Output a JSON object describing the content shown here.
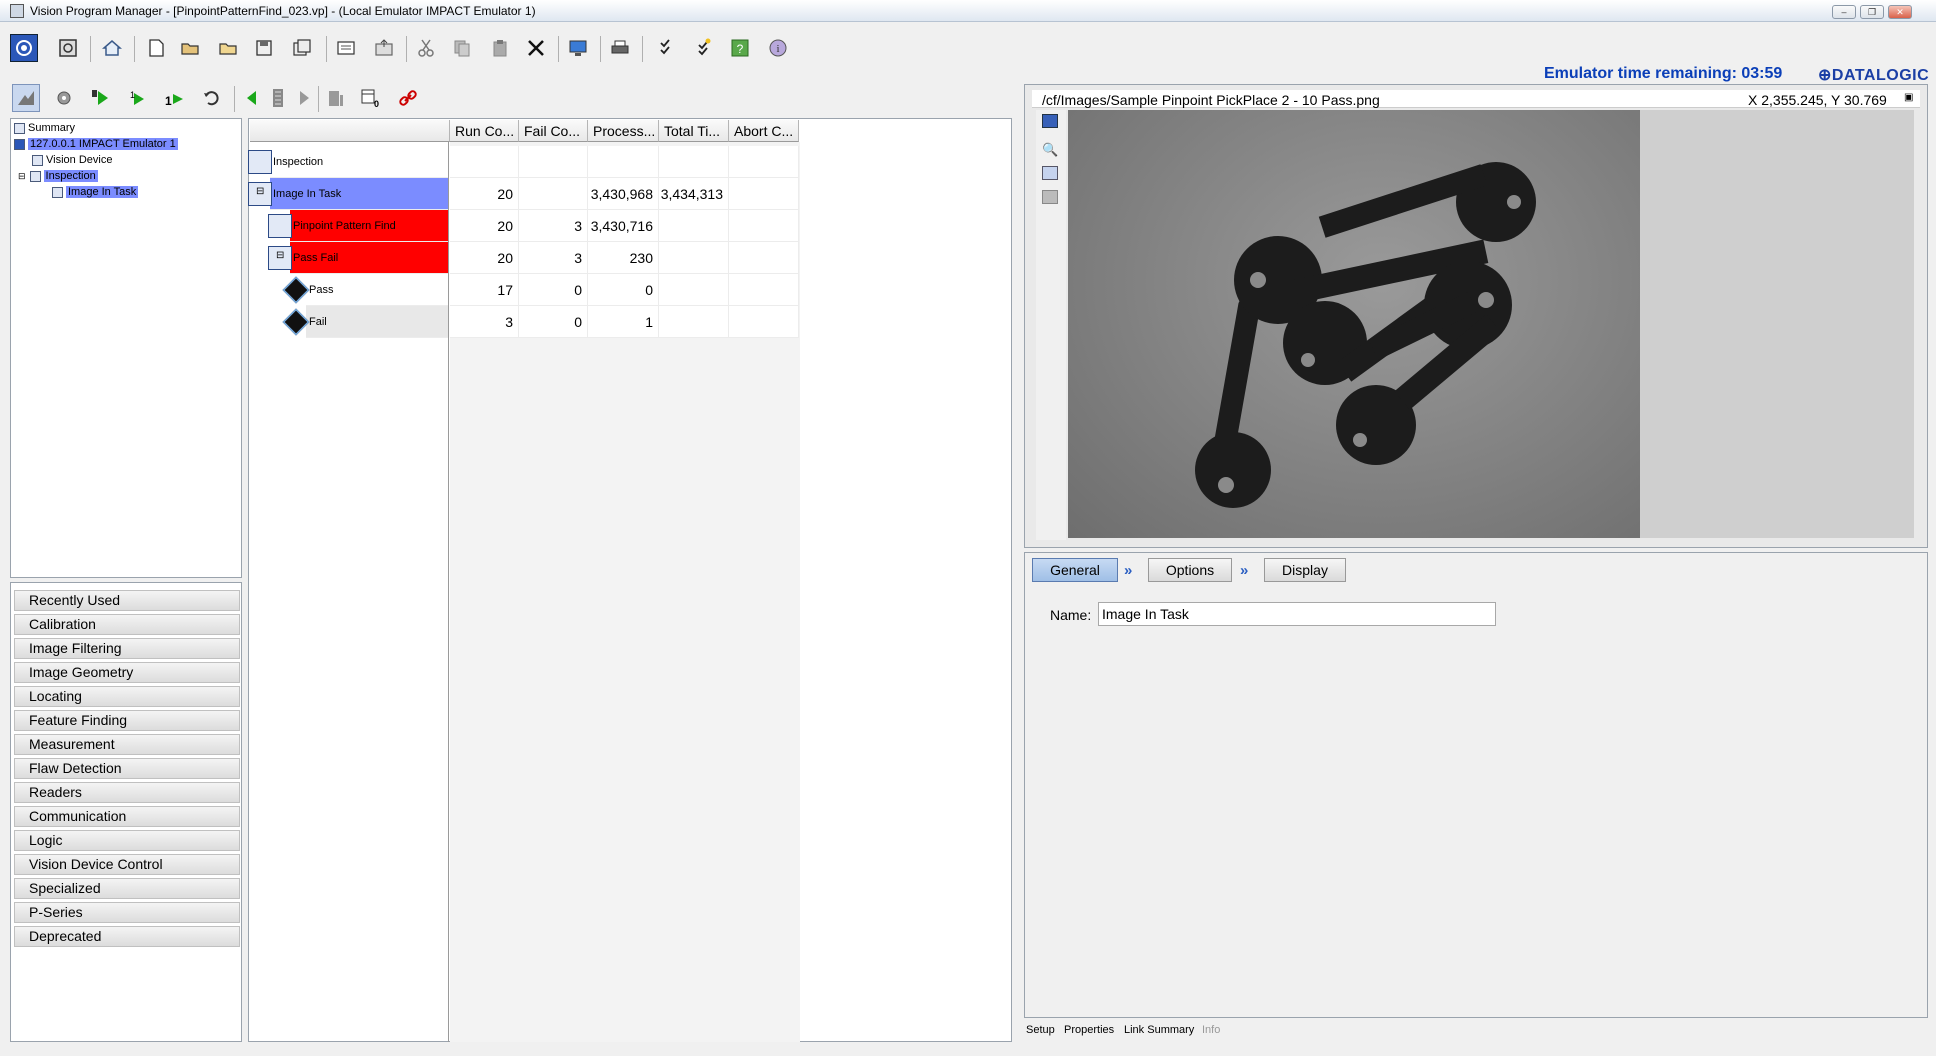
{
  "window": {
    "title": "Vision Program Manager - [PinpointPatternFind_023.vp] - (Local Emulator IMPACT Emulator 1)",
    "controls": [
      "minimize",
      "restore",
      "close"
    ]
  },
  "header": {
    "emulator_time": "Emulator time remaining: 03:59",
    "brand": "⊕DATALOGIC"
  },
  "toolbar_main": {
    "icons": [
      "camera-icon",
      "stop-icon",
      "home-icon",
      "new-file-icon",
      "open-folder-icon",
      "folder-icon",
      "save-icon",
      "save-all-icon",
      "import-icon",
      "export-icon",
      "cut-icon",
      "copy-icon",
      "paste-icon",
      "delete-icon",
      "monitor-icon",
      "print-icon",
      "checklist-icon",
      "checklist-star-icon",
      "help-icon",
      "info-icon"
    ]
  },
  "toolbar_run": {
    "icons": [
      "edit-mode-icon",
      "gear-run-icon",
      "run-icon",
      "run-once-icon",
      "run-step-icon",
      "loop-icon",
      "prev-image-icon",
      "filmstrip-icon",
      "next-image-icon",
      "record-icon",
      "calendar-counter-icon",
      "link-icon"
    ]
  },
  "tree": {
    "items": [
      {
        "label": "Summary"
      },
      {
        "label": "127.0.0.1 IMPACT Emulator 1"
      },
      {
        "label": "Vision Device"
      },
      {
        "label": "Inspection"
      },
      {
        "label": "Image In Task"
      }
    ]
  },
  "categories": [
    "Recently Used",
    "Calibration",
    "Image Filtering",
    "Image Geometry",
    "Locating",
    "Feature Finding",
    "Measurement",
    "Flaw Detection",
    "Readers",
    "Communication",
    "Logic",
    "Vision Device Control",
    "Specialized",
    "P-Series",
    "Deprecated"
  ],
  "grid": {
    "columns": [
      "Run Co...",
      "Fail Co...",
      "Process...",
      "Total Ti...",
      "Abort C..."
    ],
    "rows": [
      {
        "name": "Inspection",
        "run": "",
        "fail": "",
        "process": "",
        "total": "",
        "abort": ""
      },
      {
        "name": "Image In Task",
        "run": "20",
        "fail": "",
        "process": "3,430,968",
        "total": "3,434,313",
        "abort": ""
      },
      {
        "name": "Pinpoint Pattern Find",
        "run": "20",
        "fail": "3",
        "process": "3,430,716",
        "total": "",
        "abort": ""
      },
      {
        "name": "Pass Fail",
        "run": "20",
        "fail": "3",
        "process": "230",
        "total": "",
        "abort": ""
      },
      {
        "name": "Pass",
        "run": "17",
        "fail": "0",
        "process": "0",
        "total": "",
        "abort": ""
      },
      {
        "name": "Fail",
        "run": "3",
        "fail": "0",
        "process": "1",
        "total": "",
        "abort": ""
      }
    ]
  },
  "image_view": {
    "path": "/cf/Images/Sample Pinpoint PickPlace 2 - 10 Pass.png",
    "coords": "X 2,355.245,  Y 30.769"
  },
  "tabs": {
    "general": "General",
    "options": "Options",
    "display": "Display"
  },
  "form": {
    "name_label": "Name:",
    "name_value": "Image In Task"
  },
  "bottom_tabs": [
    "Setup",
    "Properties",
    "Link Summary",
    "Info"
  ],
  "colors": {
    "selection": "#7b8cff",
    "error_row": "#ff0000",
    "emulator_text": "#0b3fb8"
  }
}
